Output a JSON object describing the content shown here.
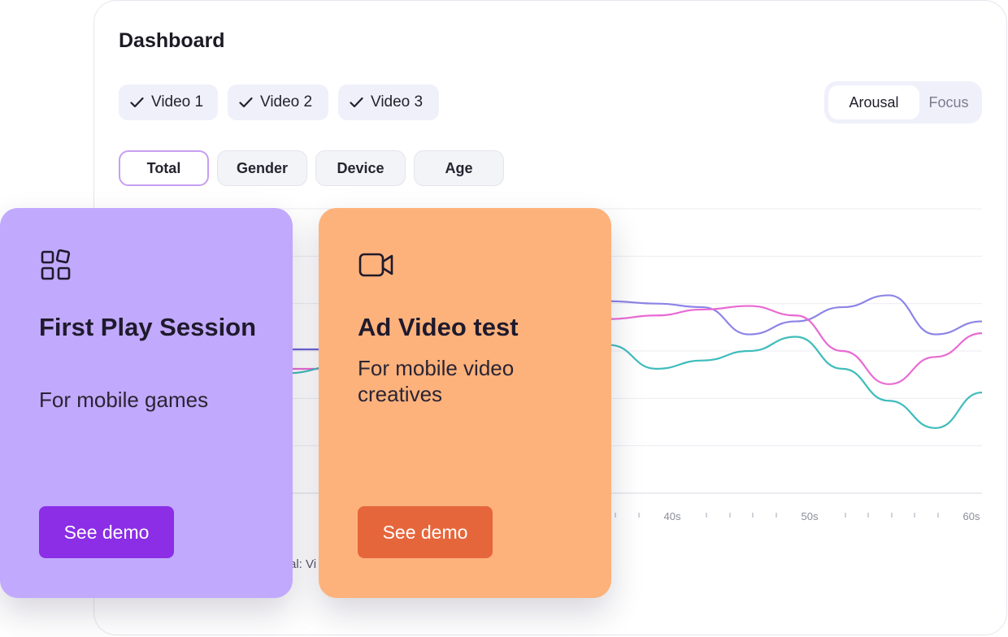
{
  "dashboard": {
    "title": "Dashboard",
    "video_chips": [
      "Video 1",
      "Video 2",
      "Video 3"
    ],
    "metric_toggle": {
      "options": [
        "Arousal",
        "Focus"
      ],
      "selected": "Arousal"
    },
    "segments": {
      "options": [
        "Total",
        "Gender",
        "Device",
        "Age"
      ],
      "selected": "Total"
    },
    "legend_fragment": "al: Vi"
  },
  "colors": {
    "series_purple": "#8c84e6",
    "series_pink": "#e96ad3",
    "series_teal": "#3fbcbc",
    "card_purple": "#c1a9fd",
    "card_orange": "#fdb27c",
    "button_purple": "#8b2ee6",
    "button_orange": "#e6663b"
  },
  "chart_data": {
    "type": "line",
    "x_tick_labels": [
      "40s",
      "50s",
      "60s"
    ],
    "grid": true,
    "series": [
      {
        "color": "#8c84e6",
        "x": [
          40,
          42.5,
          45,
          47.5,
          50,
          52.5,
          55,
          57.5,
          60
        ],
        "y": [
          1.62,
          1.6,
          1.57,
          1.34,
          1.45,
          1.57,
          1.67,
          1.34,
          1.45
        ]
      },
      {
        "color": "#e96ad3",
        "x": [
          40,
          42.5,
          45,
          47.5,
          50,
          52.5,
          55,
          57.5,
          60
        ],
        "y": [
          1.47,
          1.5,
          1.55,
          1.58,
          1.5,
          1.2,
          0.92,
          1.15,
          1.35
        ]
      },
      {
        "color": "#3fbcbc",
        "x": [
          40,
          42.5,
          45,
          47.5,
          50,
          52.5,
          55,
          57.5,
          60
        ],
        "y": [
          1.25,
          1.05,
          1.12,
          1.2,
          1.32,
          1.05,
          0.78,
          0.55,
          0.85
        ]
      }
    ]
  },
  "cards": [
    {
      "icon": "grid-icon",
      "title": "First Play Session",
      "subtitle": "For mobile games",
      "button": "See demo"
    },
    {
      "icon": "video-camera-icon",
      "title": "Ad Video test",
      "subtitle": "For mobile video creatives",
      "button": "See demo"
    }
  ]
}
